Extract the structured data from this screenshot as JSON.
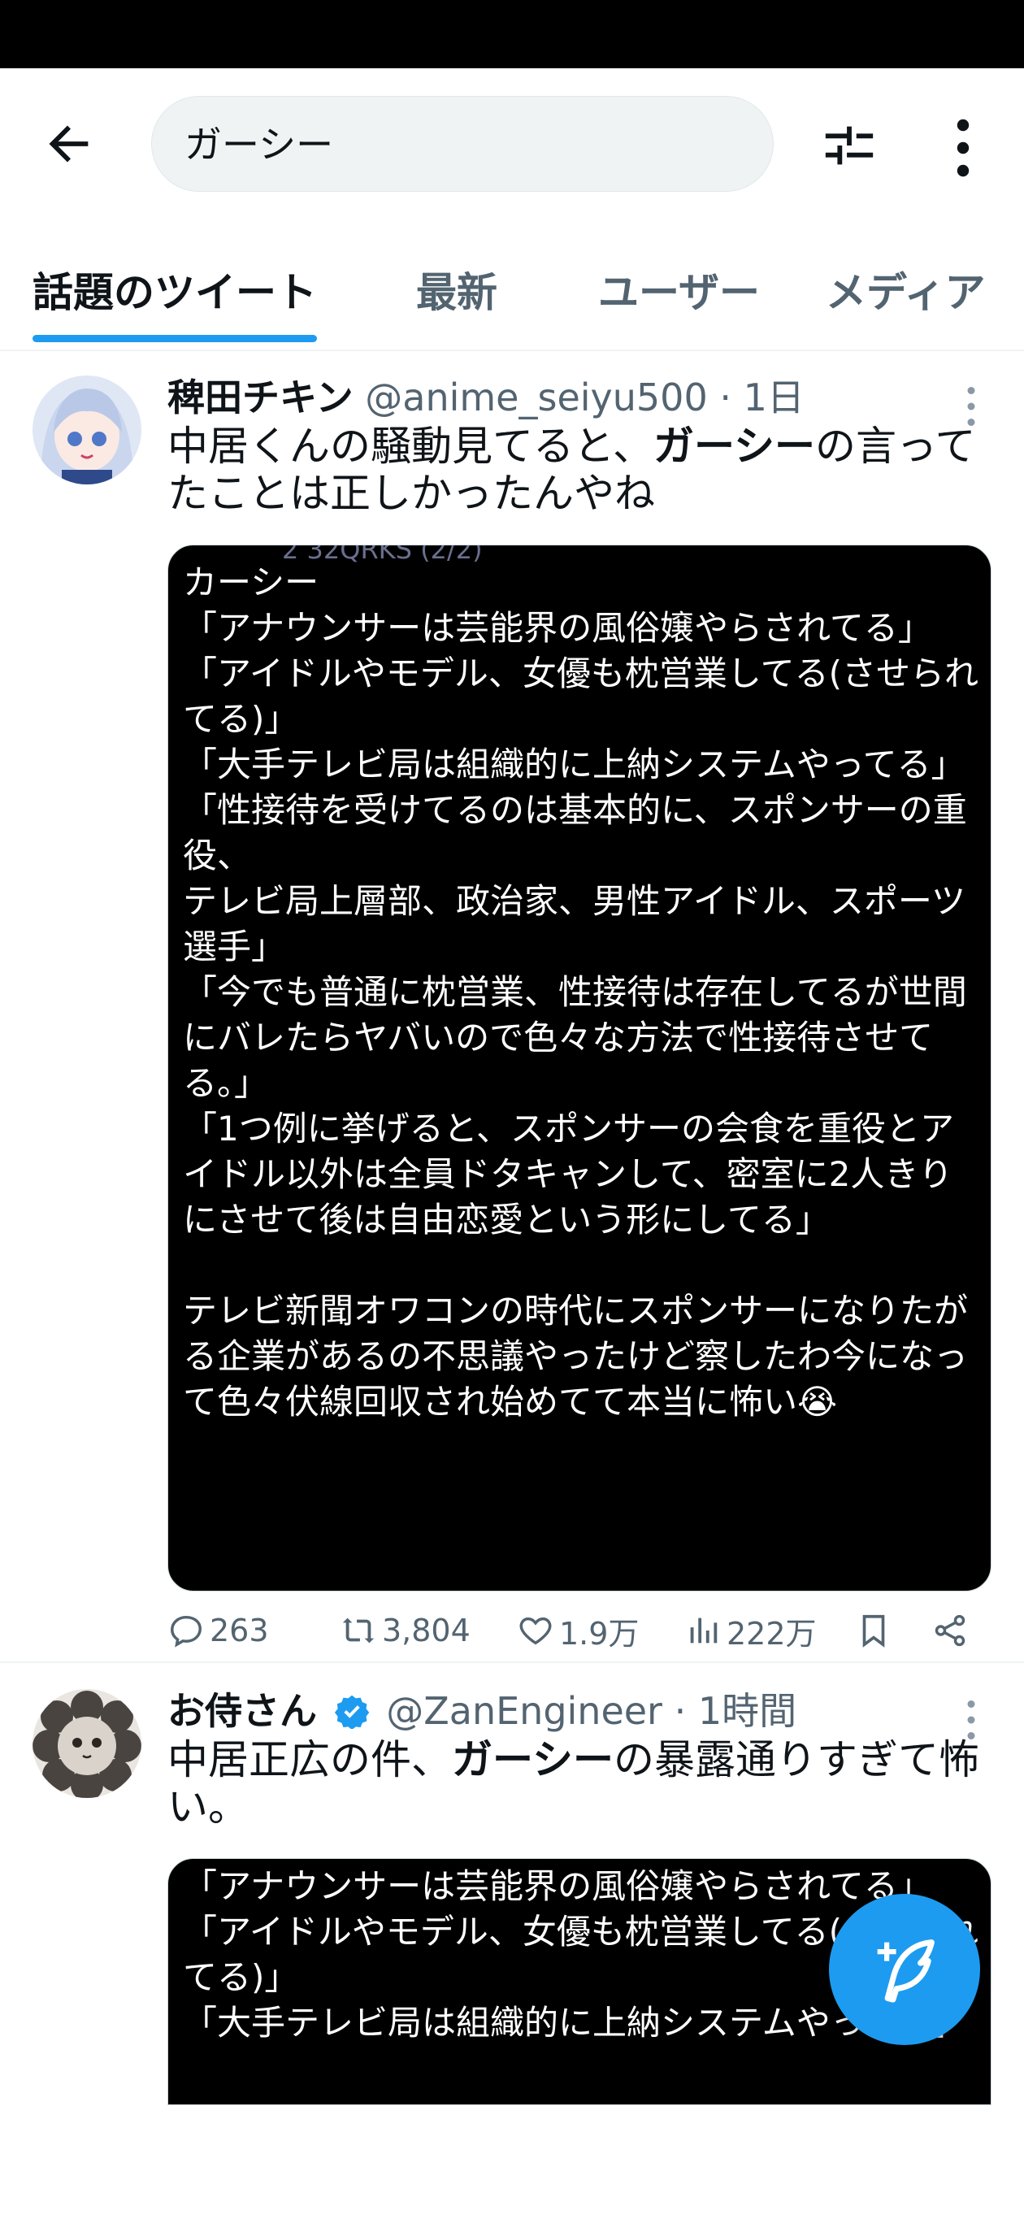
{
  "search": {
    "query": "ガーシー"
  },
  "tabs": [
    {
      "label": "話題のツイート"
    },
    {
      "label": "最新"
    },
    {
      "label": "ユーザー"
    },
    {
      "label": "メディア"
    }
  ],
  "tweets": [
    {
      "name": "稗田チキン",
      "handle": "@anime_seiyu500",
      "separator": "·",
      "time": "1日",
      "text_before": "中居くんの騒動見てると、",
      "text_bold": "ガーシー",
      "text_after": "の言ってたことは正しかったんやね",
      "media_top_fragment": "2 32QRKS (2/2)",
      "media_lines": [
        "カーシー",
        "「アナウンサーは芸能界の風俗嬢やらされてる」",
        "「アイドルやモデル、女優も枕営業してる(させられてる)」",
        "「大手テレビ局は組織的に上納システムやってる」",
        "「性接待を受けてるのは基本的に、スポンサーの重役、",
        "テレビ局上層部、政治家、男性アイドル、スポーツ選手」",
        "「今でも普通に枕営業、性接待は存在してるが世間にバレたらヤバいので色々な方法で性接待させてる。」",
        "「1つ例に挙げると、スポンサーの会食を重役とアイドル以外は全員ドタキャンして、密室に2人きりにさせて後は自由恋愛という形にしてる」",
        "",
        "テレビ新聞オワコンの時代にスポンサーになりたがる企業があるの不思議やったけど察したわ今になって色々伏線回収され始めてて本当に怖い😭"
      ],
      "stats": {
        "replies": "263",
        "retweets": "3,804",
        "likes": "1.9万",
        "views": "222万"
      }
    },
    {
      "name": "お侍さん",
      "handle": "@ZanEngineer",
      "separator": "·",
      "time": "1時間",
      "text_before": "中居正広の件、",
      "text_bold": "ガーシー",
      "text_after": "の暴露通りすぎて怖い。",
      "media_lines": [
        "「アナウンサーは芸能界の風俗嬢やらされてる」",
        "「アイドルやモデル、女優も枕営業してる(させられてる)」",
        "「大手テレビ局は組織的に上納システムやってる」"
      ]
    }
  ],
  "colors": {
    "accent": "#1d9bf0",
    "muted": "#536471",
    "text": "#0f1419",
    "verified": "#1d9bf0"
  },
  "icons": [
    "back-arrow-icon",
    "filter-sliders-icon",
    "more-vertical-icon",
    "reply-icon",
    "retweet-icon",
    "like-icon",
    "views-icon",
    "bookmark-icon",
    "share-icon",
    "compose-icon",
    "verified-badge-icon"
  ]
}
